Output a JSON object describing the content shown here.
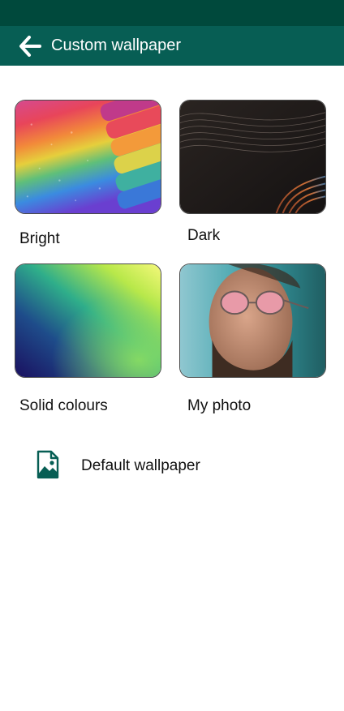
{
  "header": {
    "title": "Custom wallpaper",
    "back_icon": "arrow-left-icon"
  },
  "wallpapers": [
    {
      "label": "Bright"
    },
    {
      "label": "Dark"
    },
    {
      "label": "Solid colours"
    },
    {
      "label": "My photo"
    }
  ],
  "default_wallpaper": {
    "label": "Default wallpaper",
    "icon": "image-file-icon"
  },
  "colors": {
    "status_bar": "#00493c",
    "app_bar": "#075e54",
    "accent": "#075e54"
  }
}
